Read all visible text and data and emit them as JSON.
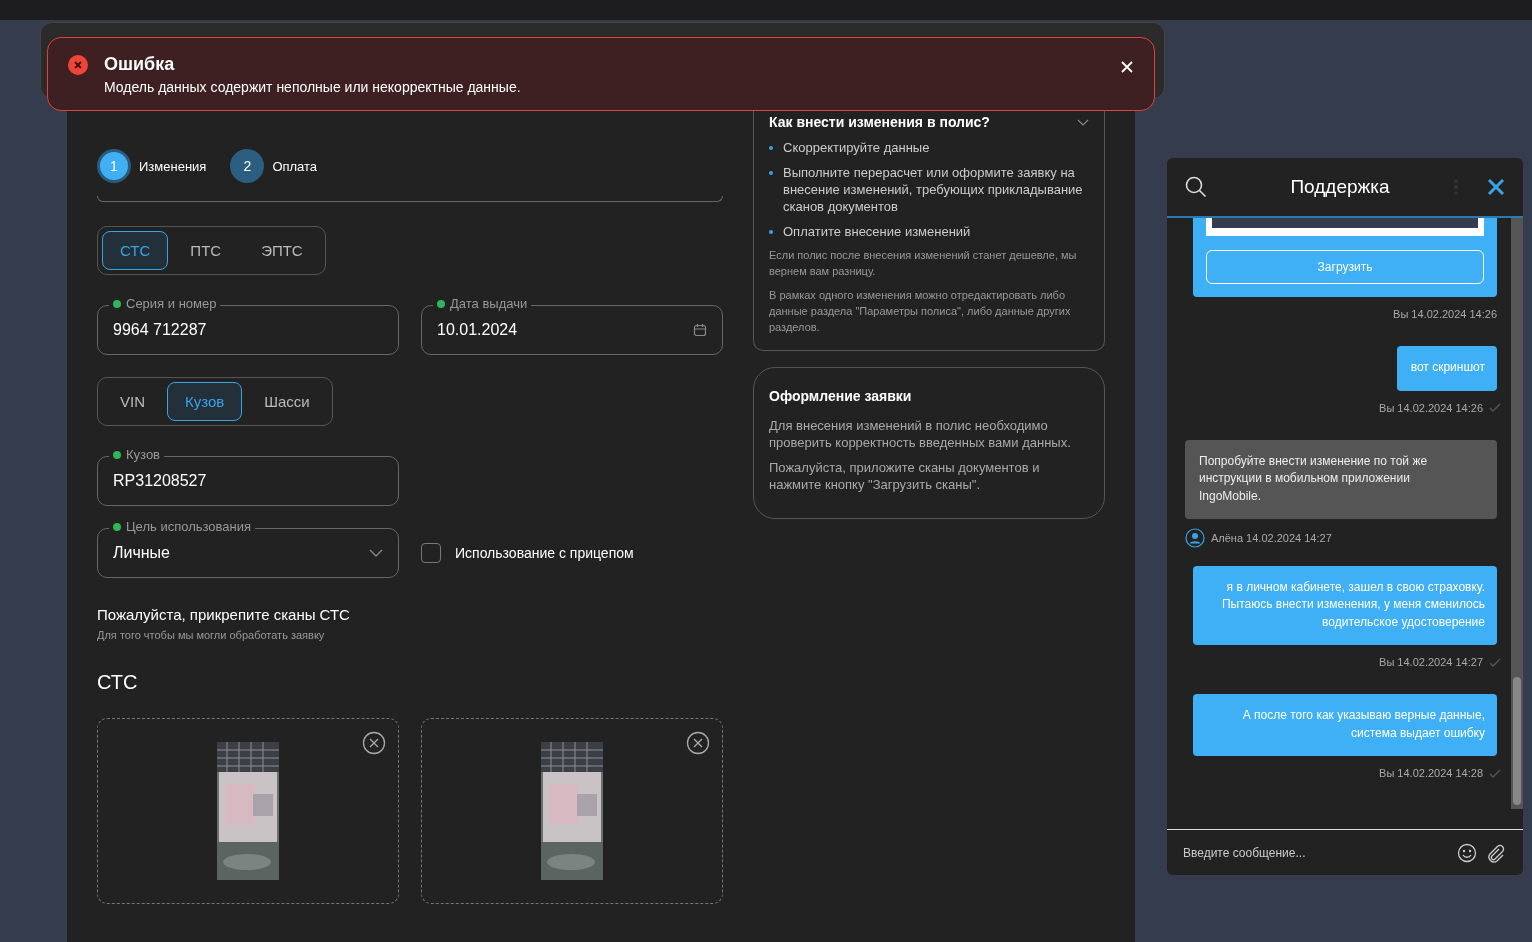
{
  "toast": {
    "title": "Ошибка",
    "message": "Модель данных содержит неполные или некорректные данные."
  },
  "steps": [
    {
      "number": "1",
      "label": "Изменения",
      "selected": true
    },
    {
      "number": "2",
      "label": "Оплата",
      "selected": false
    }
  ],
  "doc_tabs": [
    {
      "label": "СТС",
      "selected": true
    },
    {
      "label": "ПТС",
      "selected": false
    },
    {
      "label": "ЭПТС",
      "selected": false
    }
  ],
  "series_field": {
    "label": "Серия и номер",
    "value": "9964 712287",
    "valid": true
  },
  "date_field": {
    "label": "Дата выдачи",
    "value": "10.01.2024",
    "valid": true
  },
  "id_tabs": [
    {
      "label": "VIN",
      "selected": false
    },
    {
      "label": "Кузов",
      "selected": true
    },
    {
      "label": "Шасси",
      "selected": false
    }
  ],
  "body_field": {
    "label": "Кузов",
    "value": "RP31208527",
    "valid": true
  },
  "purpose_field": {
    "label": "Цель использования",
    "value": "Личные",
    "valid": true
  },
  "trailer_checkbox": {
    "label": "Использование с прицепом",
    "checked": false
  },
  "scans": {
    "title": "Пожалуйста, прикрепите сканы СТС",
    "subtitle": "Для того чтобы мы могли обработать заявку",
    "section": "СТС"
  },
  "info_card": {
    "title": "Как внести изменения в полис?",
    "expanded": true,
    "steps": [
      "Скорректируйте данные",
      "Выполните перерасчет или оформите заявку на внесение изменений, требующих прикладывание сканов документов",
      "Оплатите внесение изменений"
    ],
    "notes": [
      "Если полис после внесения изменений станет дешевле, мы вернем вам разницу.",
      "В рамках одного изменения можно отредактировать либо данные раздела \"Параметры полиса\", либо данные других разделов."
    ]
  },
  "request_card": {
    "title": "Оформление заявки",
    "paragraphs": [
      "Для внесения изменений в полис необходимо проверить корректность введенных вами данных.",
      "Пожалуйста, приложите сканы документов и нажмите кнопку \"Загрузить сканы\"."
    ]
  },
  "chat": {
    "title": "Поддержка",
    "messages": [
      {
        "kind": "attachment",
        "button": "Загрузить",
        "meta": "Вы 14.02.2024 14:26",
        "delivered": false
      },
      {
        "kind": "outgoing",
        "text": "вот скриншот",
        "meta": "Вы 14.02.2024 14:26",
        "delivered": true
      },
      {
        "kind": "incoming",
        "text": "Попробуйте внести изменение по той же инструкции в мобильном приложении IngoMobile.",
        "meta": "Алёна 14.02.2024 14:27",
        "delivered": false
      },
      {
        "kind": "outgoing",
        "text": "я в личном кабинете, зашел в свою страховку. Пытаюсь внести изменения, у меня сменилось водительское удостоверение",
        "meta": "Вы 14.02.2024 14:27",
        "delivered": true
      },
      {
        "kind": "outgoing",
        "text": "А после того как указываю верные данные, система выдает ошибку",
        "meta": "Вы 14.02.2024 14:28",
        "delivered": true
      }
    ],
    "input": {
      "placeholder": "Введите сообщение..."
    }
  }
}
